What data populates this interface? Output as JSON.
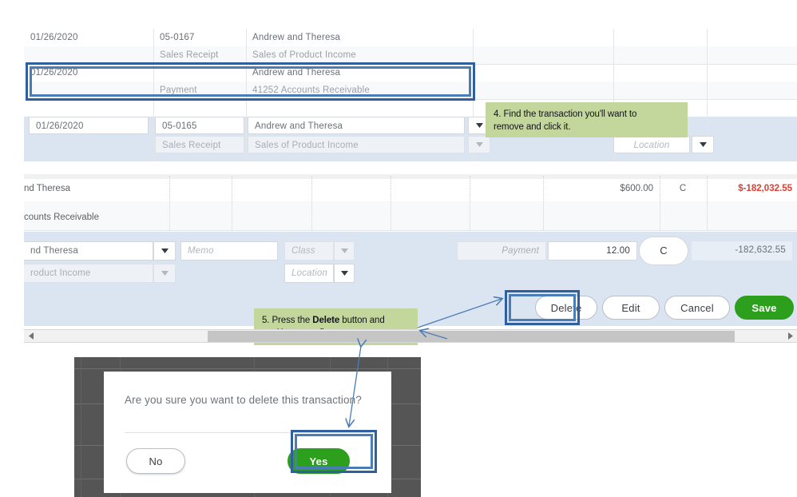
{
  "register_top": {
    "rows": [
      {
        "date": "01/26/2020",
        "ref": "05-0167",
        "type": "Sales Receipt",
        "payee": "Andrew and Theresa",
        "account": "Sales of Product Income"
      },
      {
        "date": "01/26/2020",
        "ref": "",
        "type": "Payment",
        "payee": "Andrew and Theresa",
        "account": "41252 Accounts Receivable"
      },
      {
        "date": "01/26/2020",
        "ref": "05-0165",
        "type": "Sales Receipt",
        "payee": "Andrew and Theresa",
        "account": "Sales of Product Income"
      }
    ],
    "location_placeholder": "Location"
  },
  "register_mid": {
    "payee_partial": "nd Theresa",
    "account_partial": "counts Receivable",
    "amount": "$600.00",
    "status": "C",
    "balance": "$-182,032.55"
  },
  "edit_panel": {
    "payee_partial": "nd Theresa",
    "account_partial": "roduct Income",
    "memo_placeholder": "Memo",
    "class_placeholder": "Class",
    "location_placeholder": "Location",
    "payment_placeholder": "Payment",
    "amount_value": "12.00",
    "status": "C",
    "balance": "-182,632.55",
    "buttons": {
      "delete": "Delete",
      "edit": "Edit",
      "cancel": "Cancel",
      "save": "Save"
    }
  },
  "callouts": [
    {
      "id": "step-4",
      "text_line1": "4. Find the transaction you'll want to",
      "text_line2": "remove and click it."
    },
    {
      "id": "step-5",
      "prefix1": "5. Press the ",
      "bold1": "Delete",
      "suffix1": " button and",
      "prefix2": "tap ",
      "bold2": "Yes",
      "suffix2": " to confirm."
    }
  ],
  "modal": {
    "message": "Are you sure you want to delete this transaction?",
    "no_label": "No",
    "yes_label": "Yes"
  },
  "colors": {
    "accent_blue": "#2f5f9e",
    "accent_blue_light": "#4a7cb8",
    "callout_green": "#c3d69b",
    "brand_green": "#2ca01c",
    "negative_red": "#e03c31",
    "selected_row": "#dbe5f1"
  }
}
